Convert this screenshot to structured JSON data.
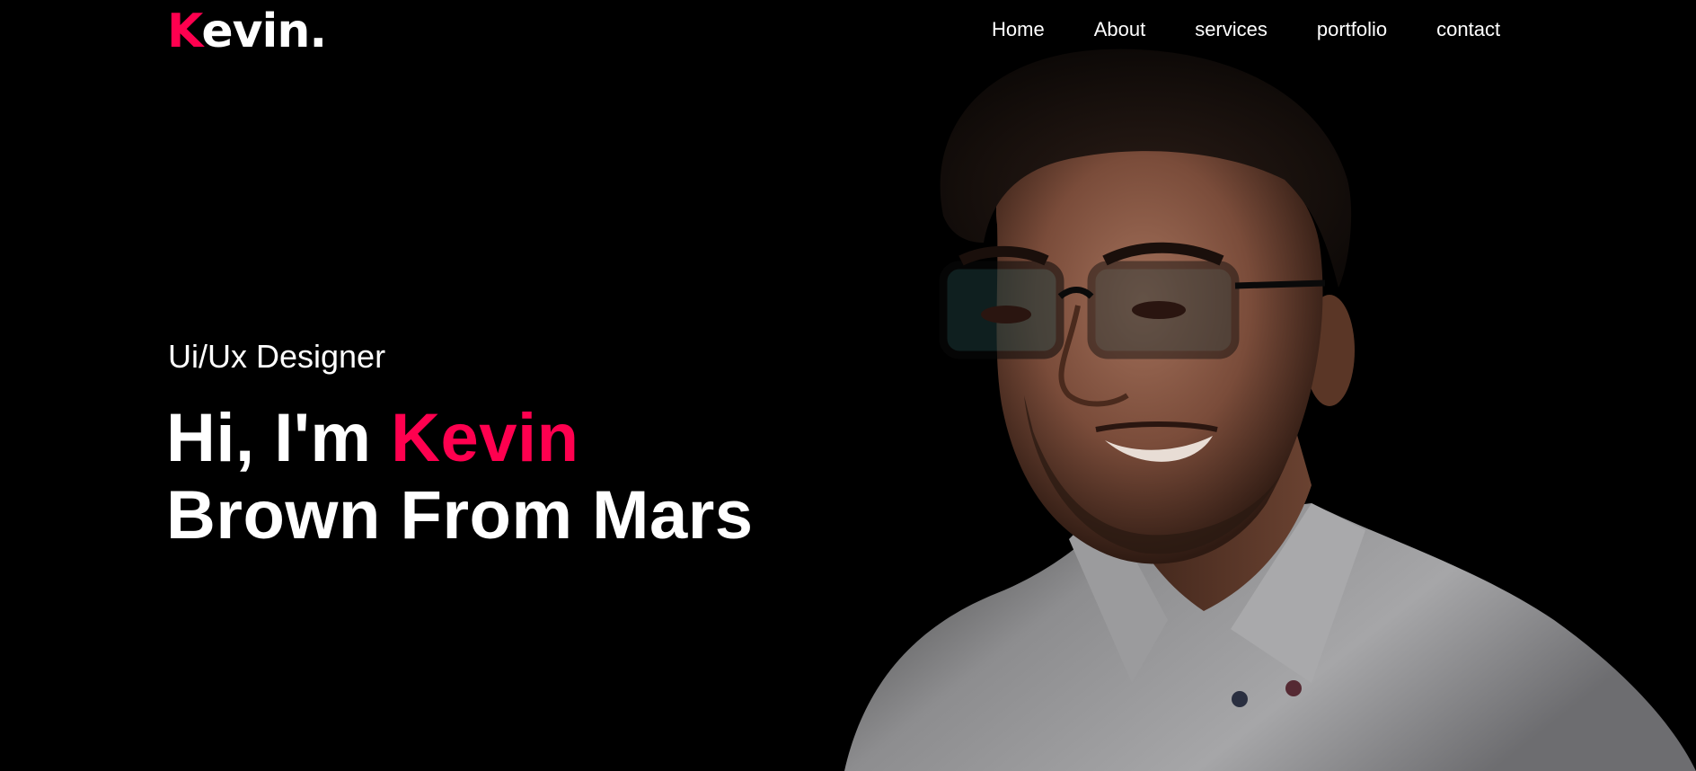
{
  "brand": {
    "logo_first": "K",
    "logo_rest": "evin",
    "logo_dot": ".",
    "accent_color": "#ff004f"
  },
  "nav": {
    "items": [
      {
        "label": "Home"
      },
      {
        "label": "About"
      },
      {
        "label": "services"
      },
      {
        "label": "portfolio"
      },
      {
        "label": "contact"
      }
    ]
  },
  "hero": {
    "subtitle": "Ui/Ux Designer",
    "greeting": "Hi, I'm",
    "name_highlight": "Kevin",
    "line2": "Brown From Mars",
    "image": "portrait-photo"
  },
  "colors": {
    "background": "#000000",
    "text": "#ffffff",
    "accent": "#ff004f"
  }
}
